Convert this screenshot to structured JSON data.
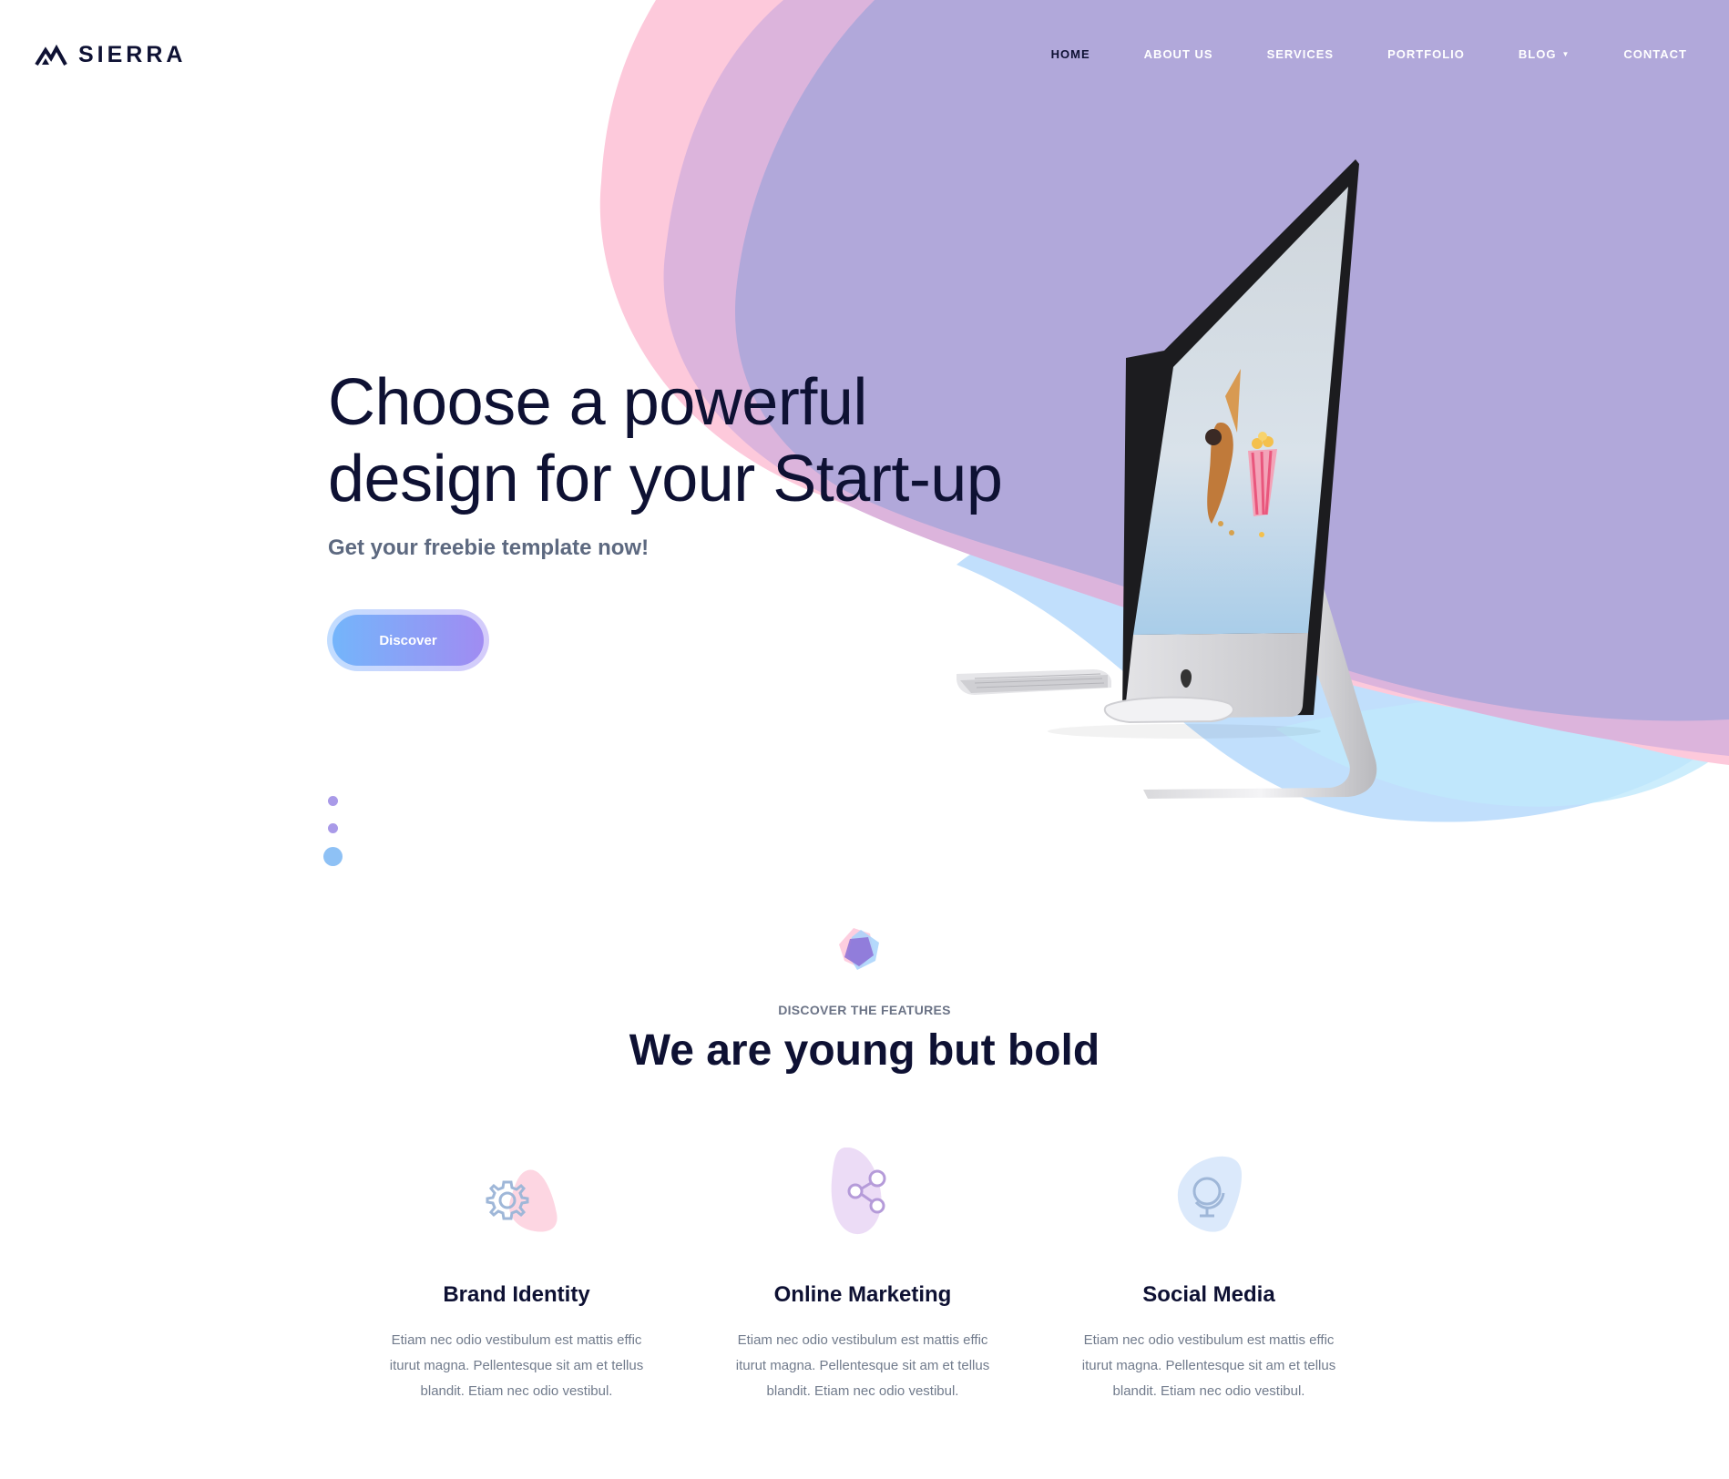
{
  "brand": {
    "name": "SIERRA",
    "logo_icon": "mountain-icon"
  },
  "nav": {
    "items": [
      {
        "label": "HOME",
        "active": true
      },
      {
        "label": "ABOUT US"
      },
      {
        "label": "SERVICES"
      },
      {
        "label": "PORTFOLIO"
      },
      {
        "label": "BLOG"
      },
      {
        "label": "CONTACT"
      }
    ],
    "blog_dropdown_icon": "caret-down-icon"
  },
  "hero": {
    "title_line1": "Choose a powerful",
    "title_line2": "design for your Start-up",
    "subtitle": "Get your freebie template now!",
    "cta_label": "Discover",
    "slider_dots": 3,
    "active_dot": 3
  },
  "features_section": {
    "eyebrow": "DISCOVER THE FEATURES",
    "title": "We are young but bold",
    "items": [
      {
        "icon": "gear-icon",
        "title": "Brand Identity",
        "text": "Etiam nec odio vestibulum est mattis effic iturut magna. Pellentesque sit am et tellus blandit. Etiam nec odio vestibul."
      },
      {
        "icon": "share-icon",
        "title": "Online Marketing",
        "text": "Etiam nec odio vestibulum est mattis effic iturut magna. Pellentesque sit am et tellus blandit. Etiam nec odio vestibul."
      },
      {
        "icon": "globe-icon",
        "title": "Social Media",
        "text": "Etiam nec odio vestibulum est mattis effic iturut magna. Pellentesque sit am et tellus blandit. Etiam nec odio vestibul."
      }
    ]
  },
  "colors": {
    "dark_text": "#0e1133",
    "pink_blob": "#fdc9db",
    "purple_blob": "#b1a8da",
    "blue_blob": "#a7d2fb",
    "accent_gradient_start": "#74b5fb",
    "accent_gradient_end": "#a08cf2"
  }
}
